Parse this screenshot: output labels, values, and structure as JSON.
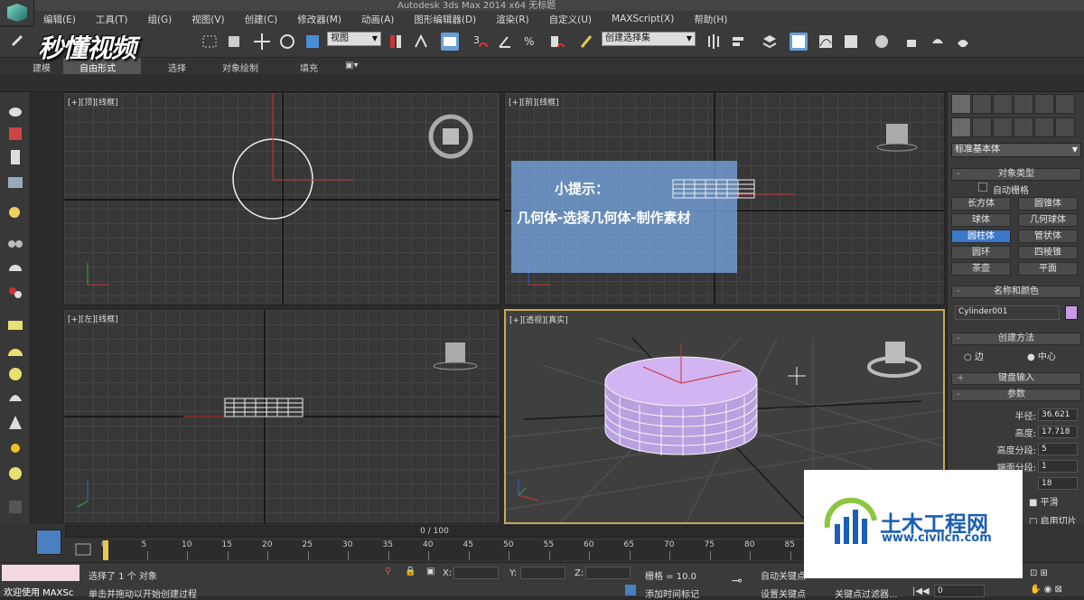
{
  "window": {
    "title": "Autodesk 3ds Max  2014 x64    无标题"
  },
  "menu": [
    "编辑(E)",
    "工具(T)",
    "组(G)",
    "视图(V)",
    "创建(C)",
    "修改器(M)",
    "动画(A)",
    "图形编辑器(D)",
    "渲染(R)",
    "自定义(U)",
    "MAXScript(X)",
    "帮助(H)"
  ],
  "toolbar": {
    "view_select": "视图",
    "selection_set": "创建选择集",
    "snap_label": "3"
  },
  "watermark": "秒懂视频",
  "ribbon": {
    "tabs": [
      "建模",
      "自由形式",
      "选择",
      "对象绘制",
      "填充"
    ],
    "active": 1
  },
  "viewports": {
    "top": "[+][顶][线框]",
    "front": "[+][前][线框]",
    "left": "[+][左][线框]",
    "persp": "[+][透视][真实]"
  },
  "tip": {
    "heading": "小提示：",
    "body": "几何体-选择几何体-制作素材"
  },
  "cmdpanel": {
    "dropdown": "标准基本体",
    "object_type": "对象类型",
    "autogrid": "自动栅格",
    "buttons": [
      "长方体",
      "圆锥体",
      "球体",
      "几何球体",
      "圆柱体",
      "管状体",
      "圆环",
      "四棱锥",
      "茶壶",
      "平面"
    ],
    "active_button": 4,
    "name_color": "名称和颜色",
    "name_value": "Cylinder001",
    "object_color": "#c99ae6",
    "creation_method": "创建方法",
    "method_edge": "边",
    "method_center": "中心",
    "keyboard_entry": "键盘输入",
    "params": "参数",
    "radius_label": "半径:",
    "radius": "36.621",
    "height_label": "高度:",
    "height": "17.718",
    "height_segs_label": "高度分段:",
    "height_segs": "5",
    "cap_segs_label": "端面分段:",
    "cap_segs": "1",
    "sides": "18",
    "smooth": "平滑",
    "slice": "启用切片"
  },
  "timeline": {
    "position": "0 / 100",
    "ticks": [
      "0",
      "5",
      "10",
      "15",
      "20",
      "25",
      "30",
      "35",
      "40",
      "45",
      "50",
      "55",
      "60",
      "65",
      "70",
      "75",
      "80",
      "85"
    ]
  },
  "status": {
    "script": "欢迎使用 MAXSc",
    "selected": "选择了 1 个 对象",
    "prompt": "单击并拖动以开始创建过程",
    "x": "X:",
    "y": "Y:",
    "z": "Z:",
    "grid": "栅格 = 10.0",
    "add_tag": "添加时间标记",
    "autokey": "自动关键点",
    "setkey": "设置关键点",
    "key_filter": "关键点过滤器...",
    "frame": "0"
  },
  "site_logo": {
    "name": "土木工程网",
    "url": "www.civilcn.com"
  }
}
